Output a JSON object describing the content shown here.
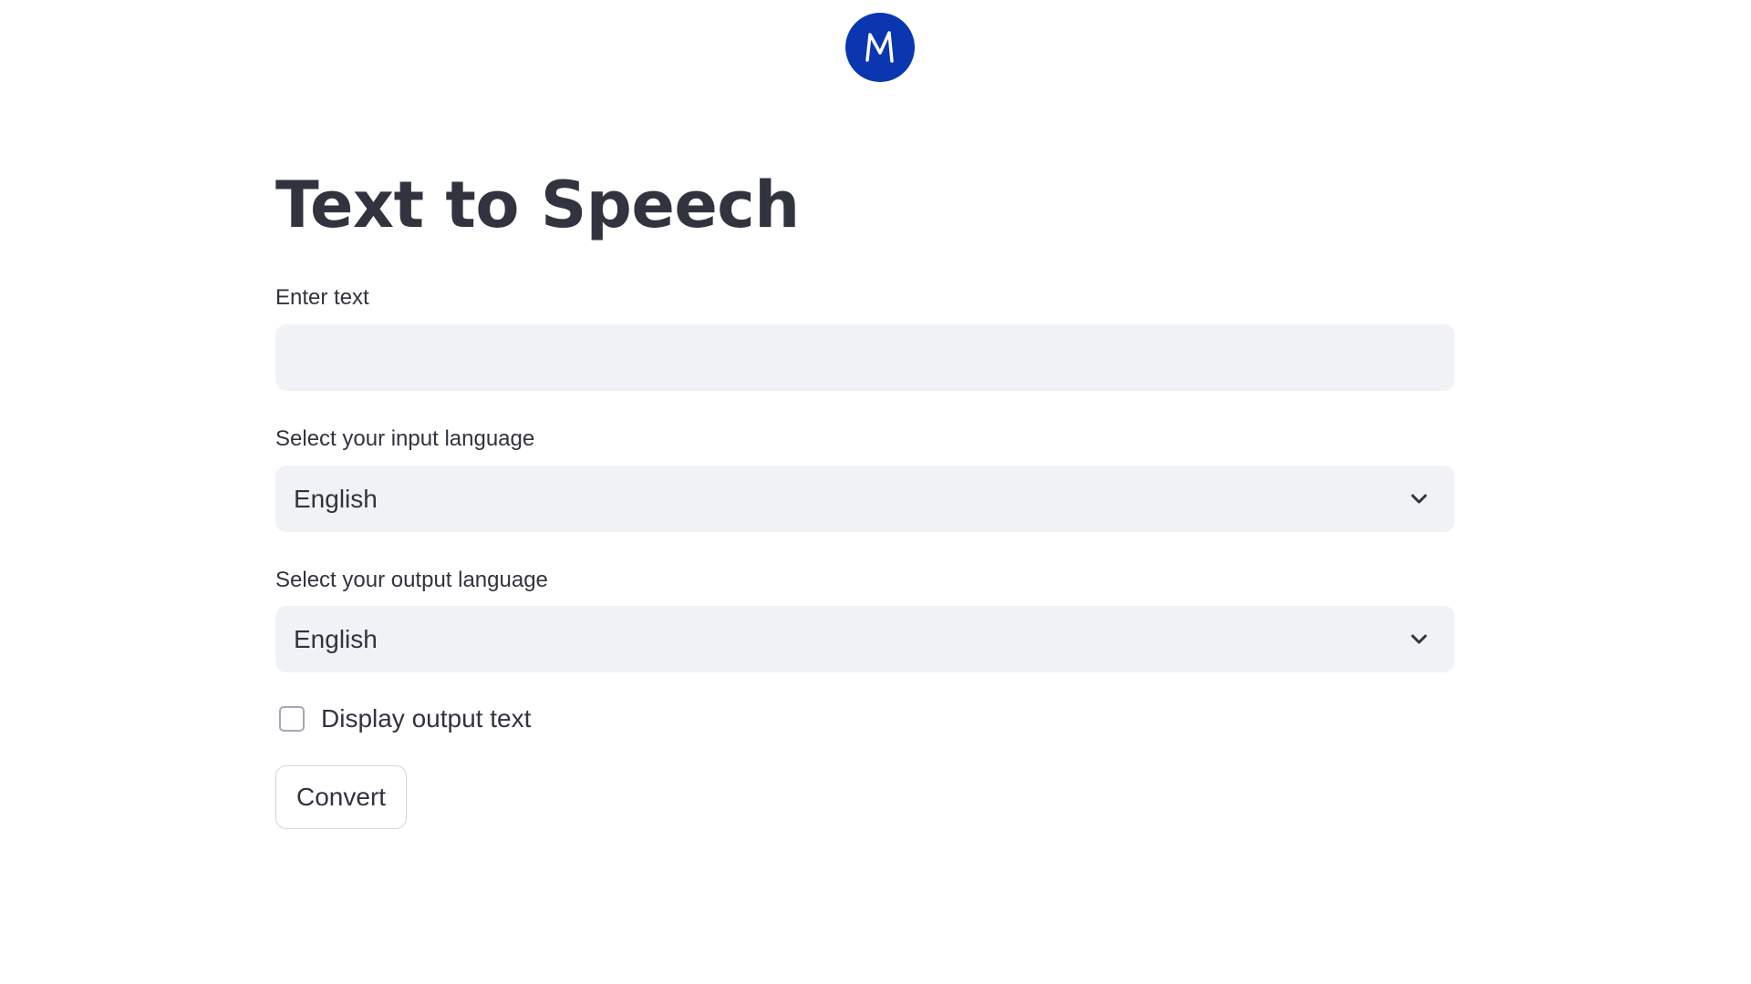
{
  "logo": {
    "letter": "M",
    "color": "#0a37b0",
    "icon": "m-logo-icon"
  },
  "page": {
    "title": "Text to Speech"
  },
  "form": {
    "text_label": "Enter text",
    "text_value": "",
    "text_placeholder": "",
    "input_language_label": "Select your input language",
    "input_language_value": "English",
    "output_language_label": "Select your output language",
    "output_language_value": "English",
    "display_output_label": "Display output text",
    "display_output_checked": false,
    "convert_label": "Convert"
  },
  "colors": {
    "field_background": "#f0f2f6",
    "text": "#31333f",
    "logo_blue": "#0a37b0"
  }
}
